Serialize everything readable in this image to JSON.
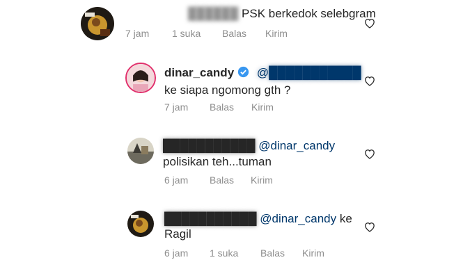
{
  "comments": [
    {
      "hidden_username": "██████",
      "text": "PSK berkedok selebgram",
      "time": "7 jam",
      "likes": "1 suka",
      "reply": "Balas",
      "send": "Kirim"
    },
    {
      "username": "dinar_candy",
      "hidden_mention": "@███████████",
      "text": "ke siapa ngomong gth ?",
      "time": "7 jam",
      "reply": "Balas",
      "send": "Kirim"
    },
    {
      "hidden_username": "███████████",
      "mention": "@dinar_candy",
      "text": "polisikan teh...tuman",
      "time": "6 jam",
      "reply": "Balas",
      "send": "Kirim"
    },
    {
      "hidden_username": "███████████",
      "mention": "@dinar_candy",
      "mention_suffix": "ke",
      "text": "Ragil",
      "time": "6 jam",
      "likes": "1 suka",
      "reply": "Balas",
      "send": "Kirim"
    }
  ],
  "colors": {
    "link": "#00376b",
    "meta": "#8e8e8e",
    "verified": "#3897f0",
    "text": "#262626"
  }
}
